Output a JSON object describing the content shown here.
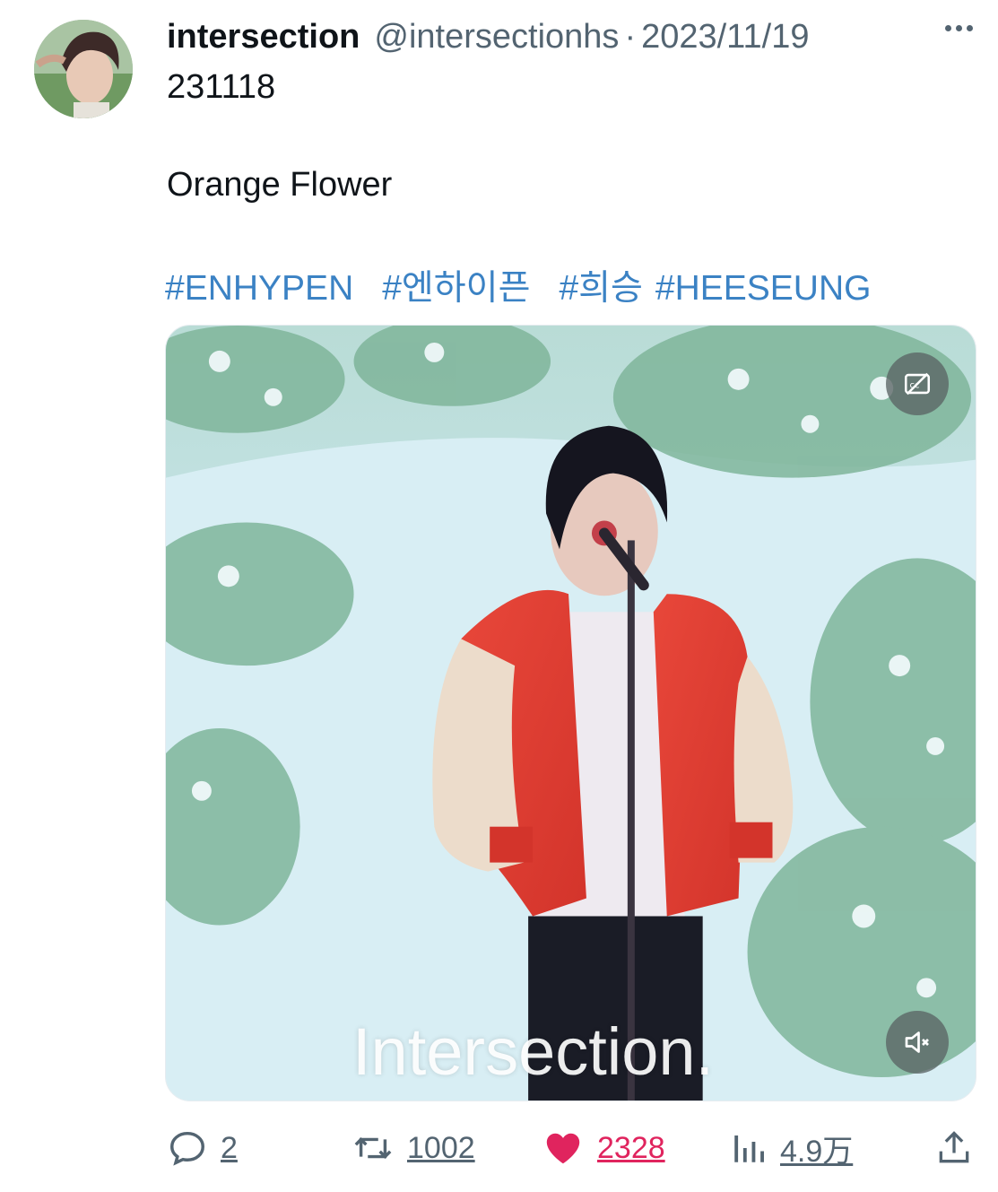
{
  "tweet": {
    "display_name": "intersection",
    "handle": "@intersectionhs",
    "separator": "·",
    "date": "2023/11/19",
    "line1": "231118",
    "line2": "Orange Flower",
    "hashtags": [
      "#ENHYPEN",
      "#엔하이픈",
      "#희승",
      "#HEESEUNG"
    ]
  },
  "media": {
    "watermark": "Intersection.",
    "cc_icon": "captions-off-icon",
    "mute_icon": "volume-muted-icon"
  },
  "actions": {
    "reply_count": "2",
    "retweet_count": "1002",
    "like_count": "2328",
    "views_count": "4.9万",
    "like_color": "#e0245e"
  },
  "icons": {
    "reply": "reply-icon",
    "retweet": "retweet-icon",
    "like": "heart-icon",
    "views": "views-icon",
    "share": "share-icon",
    "more": "more-icon"
  }
}
